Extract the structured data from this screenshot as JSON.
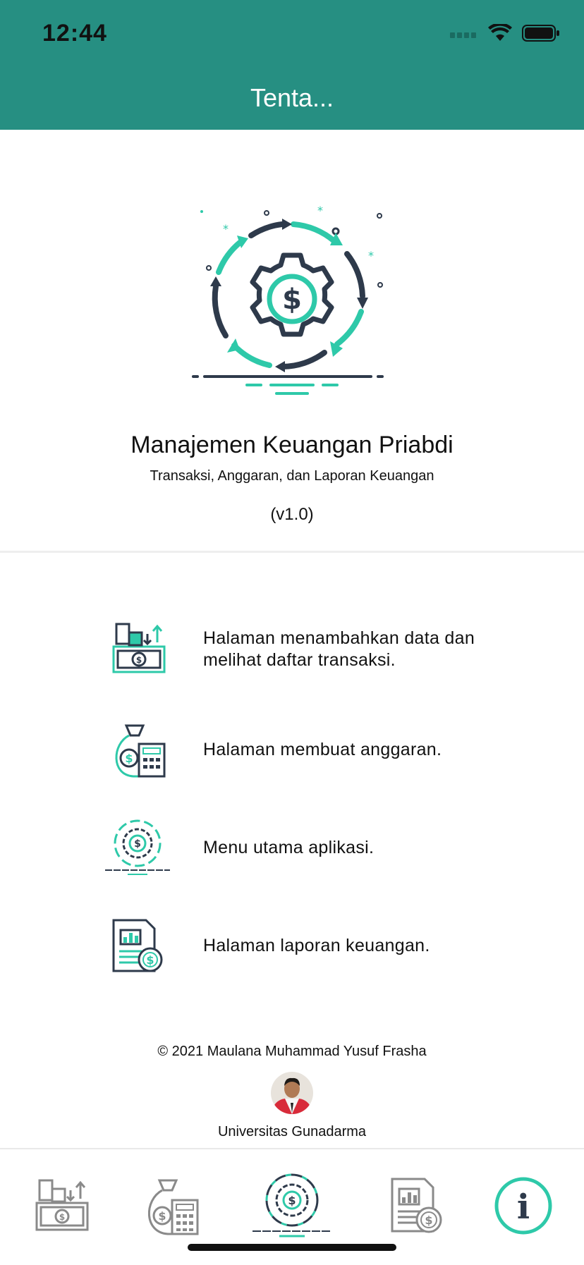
{
  "status_bar": {
    "time": "12:44"
  },
  "header": {
    "title": "Tenta..."
  },
  "about": {
    "app_name": "Manajemen Keuangan Priabdi",
    "subtitle": "Transaksi, Anggaran, dan Laporan Keuangan",
    "version": "(v1.0)"
  },
  "features": [
    {
      "icon": "transaction-money-icon",
      "text": "Halaman menambahkan data dan melihat daftar transaksi."
    },
    {
      "icon": "budget-bag-calculator-icon",
      "text": "Halaman membuat anggaran."
    },
    {
      "icon": "gear-dollar-cycle-icon",
      "text": "Menu utama aplikasi."
    },
    {
      "icon": "report-document-icon",
      "text": "Halaman laporan keuangan."
    }
  ],
  "footer": {
    "copyright": "© 2021 Maulana Muhammad Yusuf Frasha",
    "university": "Universitas Gunadarma"
  },
  "tabs": [
    {
      "name": "transactions",
      "icon": "transaction-money-icon"
    },
    {
      "name": "budget",
      "icon": "budget-bag-calculator-icon"
    },
    {
      "name": "home",
      "icon": "gear-dollar-cycle-icon"
    },
    {
      "name": "report",
      "icon": "report-document-icon"
    },
    {
      "name": "info",
      "icon": "info-icon",
      "selected": true
    }
  ],
  "colors": {
    "header": "#268F82",
    "accent": "#2EC9A9",
    "dark": "#2E3A4B",
    "tab_inactive": "#8A8A8A"
  }
}
